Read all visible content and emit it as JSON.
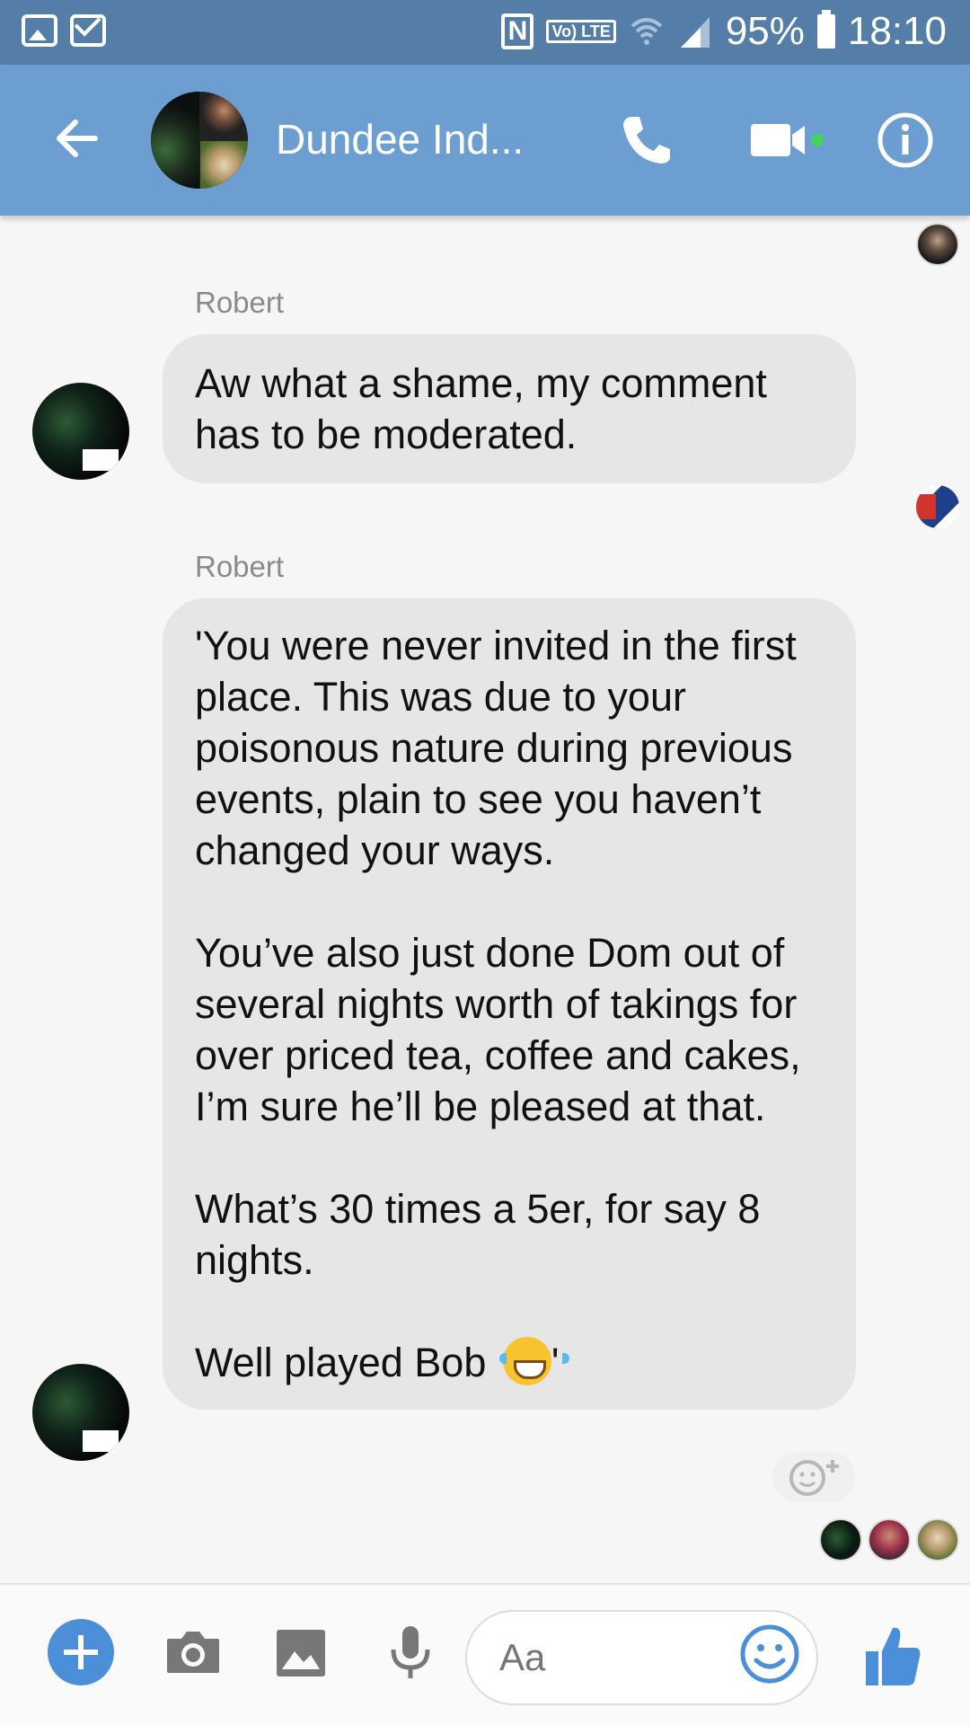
{
  "status_bar": {
    "battery": "95%",
    "time": "18:10",
    "network": "Vo) LTE"
  },
  "header": {
    "title": "Dundee Ind..."
  },
  "messages": [
    {
      "sender": "Robert",
      "text": "Aw what a shame, my comment has to be moderated."
    },
    {
      "sender": "Robert",
      "paragraphs": [
        "'You were never invited in the first place. This was due to your poisonous nature during previous events, plain to see you haven’t changed your ways.",
        "You’ve also just done Dom out of several nights worth of takings for over priced tea, coffee and cakes, I’m sure he’ll be pleased at that.",
        "What’s 30 times a 5er, for say 8 nights.",
        "Well played Bob"
      ],
      "trailing": "'"
    }
  ],
  "composer": {
    "placeholder": "Aa"
  },
  "colors": {
    "status_bar": "#547ea8",
    "header": "#6c9ed2",
    "bubble": "#e6e6e6",
    "accent": "#4a8fd8",
    "online_dot": "#44d35a"
  },
  "icons": [
    "back-arrow-icon",
    "phone-icon",
    "video-camera-icon",
    "info-icon",
    "add-icon",
    "camera-icon",
    "gallery-icon",
    "microphone-icon",
    "emoji-icon",
    "thumbs-up-icon",
    "add-reaction-icon"
  ]
}
